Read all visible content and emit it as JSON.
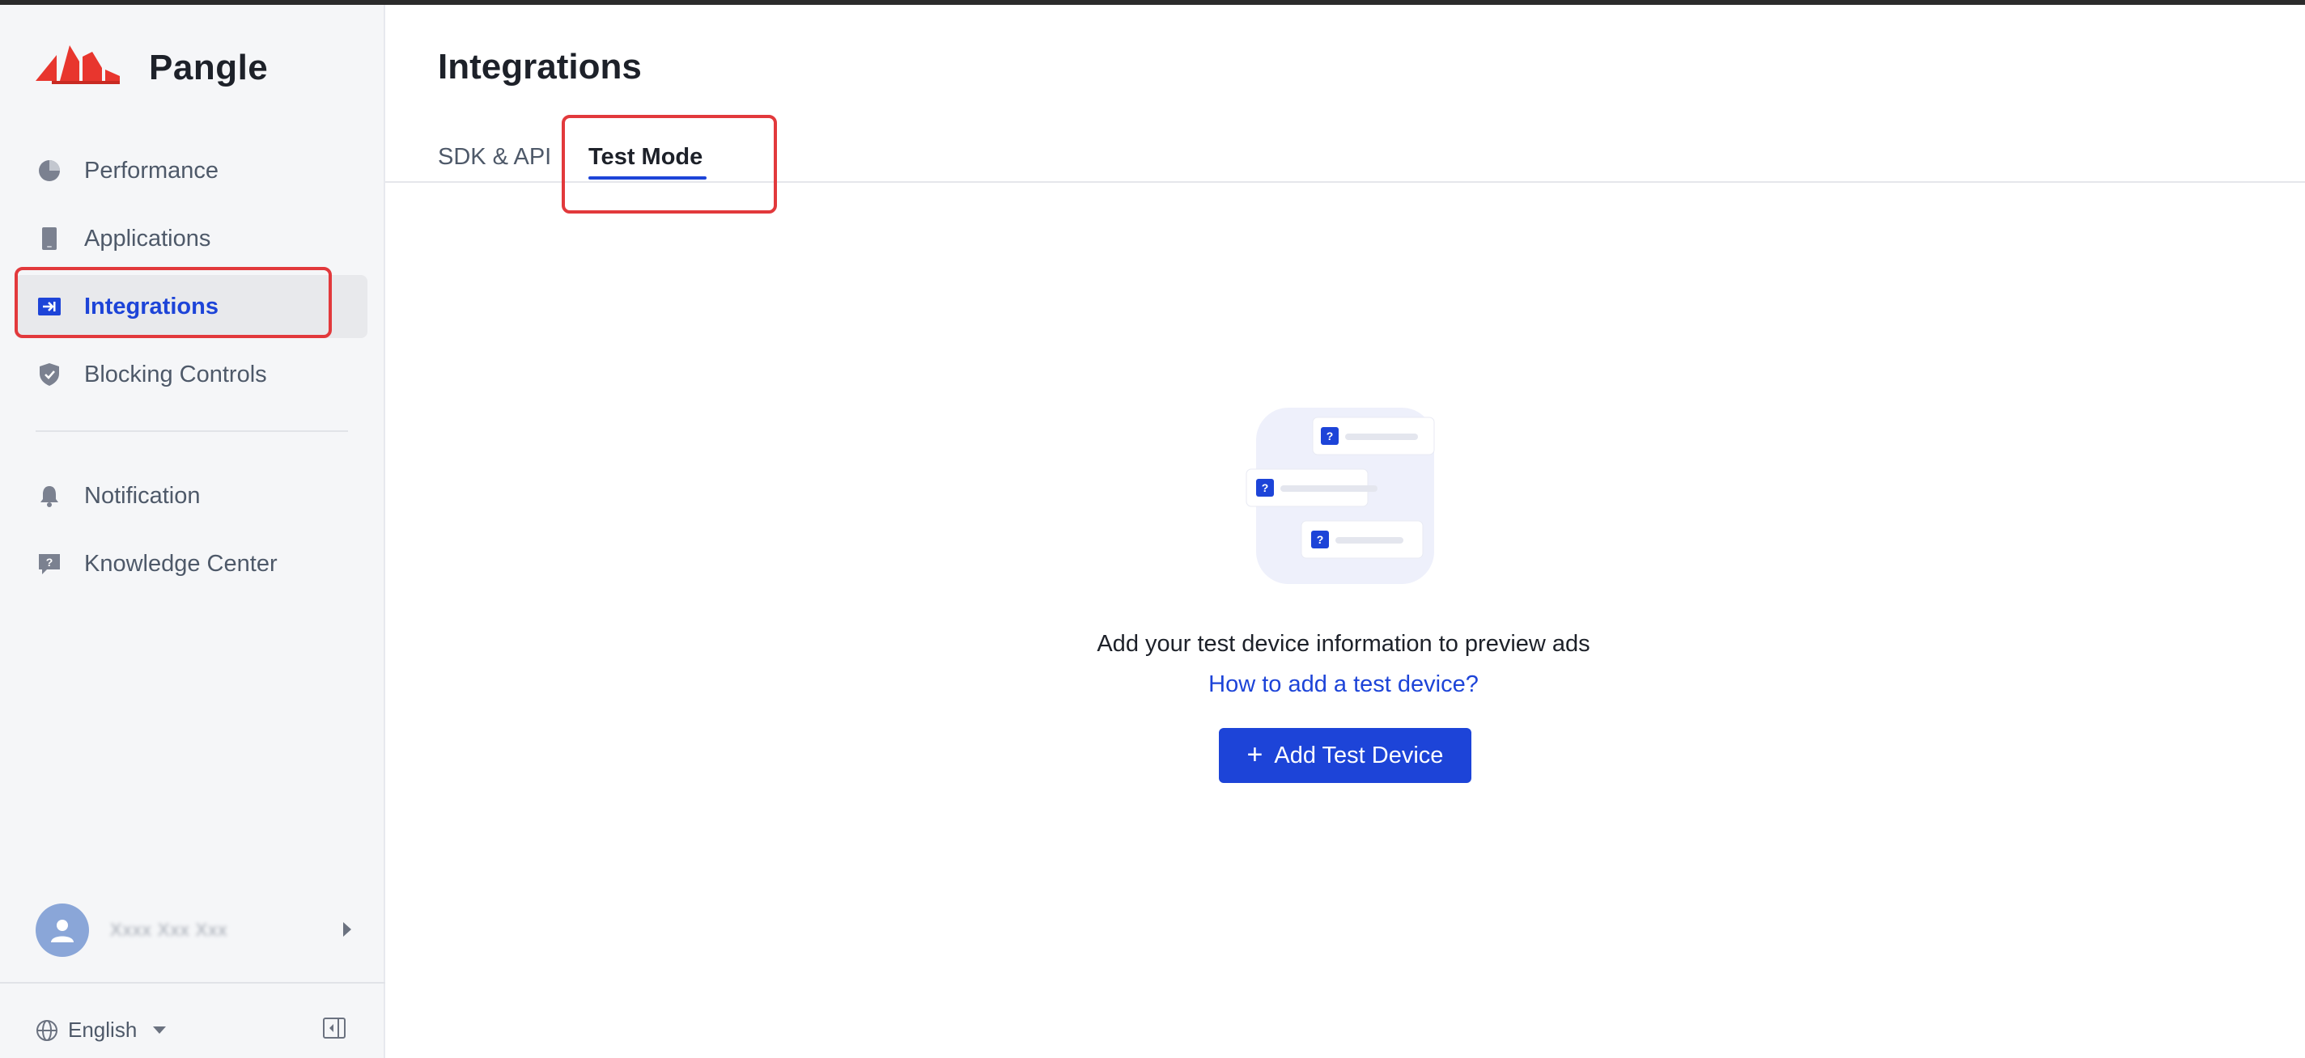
{
  "app": {
    "brand": "Pangle"
  },
  "sidebar": {
    "items": [
      {
        "label": "Performance",
        "icon": "pie-chart-icon"
      },
      {
        "label": "Applications",
        "icon": "phone-icon"
      },
      {
        "label": "Integrations",
        "icon": "integration-icon",
        "active": true
      },
      {
        "label": "Blocking Controls",
        "icon": "shield-icon"
      },
      {
        "label": "Notification",
        "icon": "bell-icon"
      },
      {
        "label": "Knowledge Center",
        "icon": "help-bubble-icon"
      }
    ],
    "user": {
      "name": "Xxxx Xxx Xxx"
    },
    "language": "English"
  },
  "main": {
    "title": "Integrations",
    "tabs": [
      {
        "label": "SDK & API"
      },
      {
        "label": "Test Mode",
        "active": true
      }
    ],
    "empty_state": {
      "message": "Add your test device information to preview ads",
      "help_link": "How to add a test device?",
      "button_label": "Add Test Device",
      "button_icon": "plus-icon"
    }
  },
  "colors": {
    "accent": "#1d44d8",
    "highlight": "#e2393c",
    "brand_red": "#e8362e"
  }
}
